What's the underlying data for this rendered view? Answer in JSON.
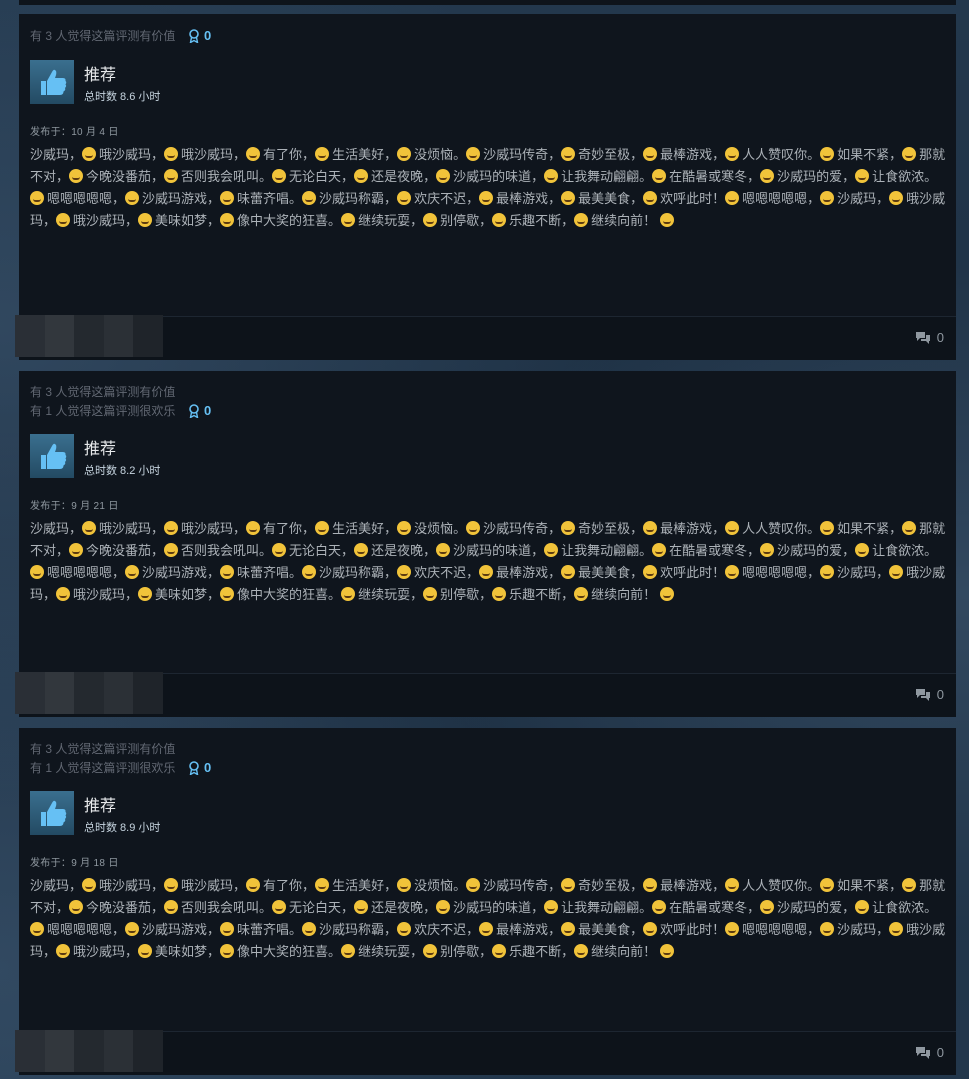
{
  "reviews": [
    {
      "helpful_lines": [
        "有 3 人觉得这篇评测有价值"
      ],
      "award_count": "0",
      "recommendation": "推荐",
      "hours": "总时数 8.6 小时",
      "posted": "发布于：10 月 4 日",
      "comment_count": "0"
    },
    {
      "helpful_lines": [
        "有 3 人觉得这篇评测有价值",
        "有 1 人觉得这篇评测很欢乐"
      ],
      "award_count": "0",
      "recommendation": "推荐",
      "hours": "总时数 8.2 小时",
      "posted": "发布于：9 月 21 日",
      "comment_count": "0"
    },
    {
      "helpful_lines": [
        "有 3 人觉得这篇评测有价值",
        "有 1 人觉得这篇评测很欢乐"
      ],
      "award_count": "0",
      "recommendation": "推荐",
      "hours": "总时数 8.9 小时",
      "posted": "发布于：9 月 18 日",
      "comment_count": "0"
    }
  ],
  "review_text_segments": [
    "沙威玛，",
    "哦沙威玛，",
    "哦沙威玛，",
    "有了你，",
    "生活美好，",
    "没烦恼。",
    "沙威玛传奇，",
    "奇妙至极，",
    "最棒游戏，",
    "人人赞叹你。",
    "如果不紧，",
    "那就不对，",
    "今晚没番茄，",
    "否则我会吼叫。",
    "无论白天，",
    "还是夜晚，",
    "沙威玛的味道，",
    "让我舞动翩翩。",
    "在酷暑或寒冬，",
    "沙威玛的爱，",
    "让食欲浓。",
    "嗯嗯嗯嗯嗯，",
    "沙威玛游戏，",
    "味蕾齐唱。",
    "沙威玛称霸，",
    "欢庆不迟，",
    "最棒游戏，",
    "最美美食，",
    "欢呼此时！",
    "嗯嗯嗯嗯嗯，",
    "沙威玛，",
    "哦沙威玛，",
    "哦沙威玛，",
    "美味如梦，",
    "像中大奖的狂喜。",
    "继续玩耍，",
    "别停歇，",
    "乐趣不断，",
    "继续向前！"
  ],
  "icons": {
    "award": "award-ribbon-icon",
    "thumb": "thumbs-up-icon",
    "comment": "comment-bubbles-icon",
    "emoji": "emoji-face-icon"
  },
  "colors": {
    "accent": "#66c0f4",
    "card": "#0f151d",
    "text": "#acb2b8"
  }
}
